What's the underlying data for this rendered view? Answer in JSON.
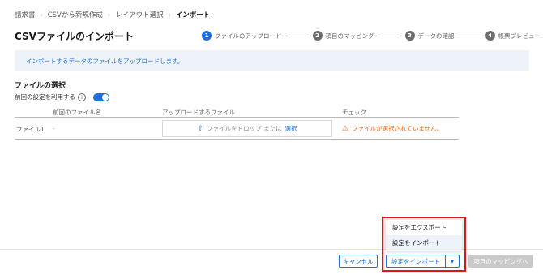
{
  "breadcrumb": {
    "items": [
      "請求書",
      "CSVから新規作成",
      "レイアウト選択",
      "インポート"
    ]
  },
  "page_title": "CSVファイルのインポート",
  "stepper": [
    {
      "num": "1",
      "label": "ファイルのアップロード",
      "active": true
    },
    {
      "num": "2",
      "label": "項目のマッピング",
      "active": false
    },
    {
      "num": "3",
      "label": "データの確認",
      "active": false
    },
    {
      "num": "4",
      "label": "帳票プレビュー",
      "active": false
    }
  ],
  "info_message": "インポートするデータのファイルをアップロードします。",
  "file_section": {
    "title": "ファイルの選択",
    "reuse_label": "前回の設定を利用する",
    "reuse_enabled": true
  },
  "table": {
    "headers": [
      "前回のファイル名",
      "アップロードするファイル",
      "チェック"
    ],
    "rows": [
      {
        "label": "ファイル1",
        "previous": "-",
        "dropzone_text": "ファイルをドロップ または",
        "dropzone_link": "選択",
        "check": "ファイルが選択されていません。"
      }
    ]
  },
  "dropdown_menu": {
    "items": [
      "設定をエクスポート",
      "設定をインポート"
    ],
    "hovered_index": 1
  },
  "footer": {
    "cancel": "キャンセル",
    "import_settings": "設定をインポート",
    "caret": "▼",
    "next": "項目のマッピングへ"
  },
  "colors": {
    "accent": "#1e6fd9",
    "warning": "#e06a1a",
    "highlight": "#e0151b",
    "disabled": "#c9c9c9"
  }
}
